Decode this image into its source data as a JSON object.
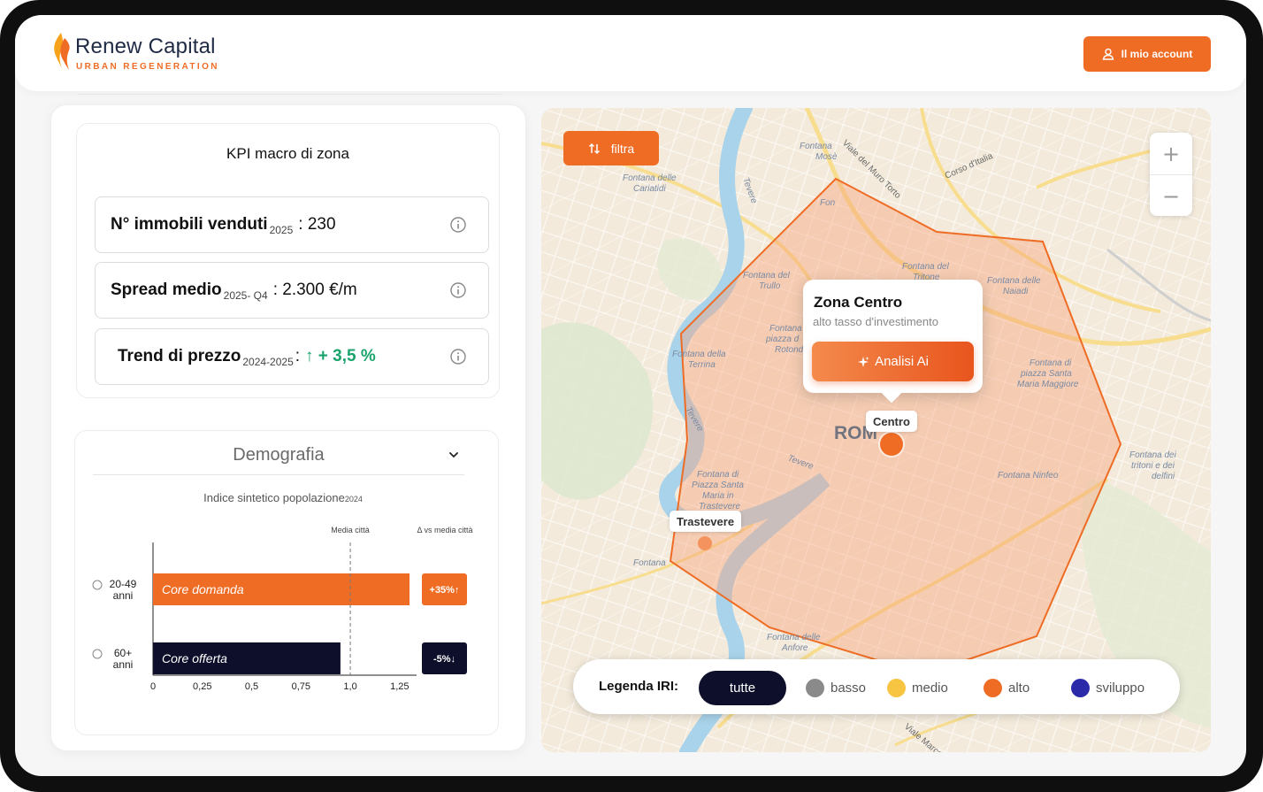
{
  "brand": {
    "name": "Renew Capital",
    "tagline": "URBAN REGENERATION",
    "orange": "#ef6c25",
    "navy": "#0d0f2b"
  },
  "header": {
    "account_label": "Il mio account"
  },
  "kpi": {
    "title": "KPI macro di zona",
    "rows": [
      {
        "label": "N° immobili venduti",
        "sub": "2025",
        "value": ": 230"
      },
      {
        "label": "Spread medio",
        "sub": "2025- Q4",
        "value": ":  2.300 €/m"
      },
      {
        "label": "Trend di prezzo",
        "sub": "2024-2025",
        "value": ":",
        "trend": "↑ + 3,5 %",
        "trend_color": "#1aa36b"
      }
    ]
  },
  "demografia": {
    "title": "Demografia",
    "chart_data": {
      "type": "bar",
      "orientation": "horizontal",
      "title": "Indice sintetico popolazione",
      "title_sub": "2024",
      "categories": [
        "20-49 anni",
        "60+ anni"
      ],
      "category_lines": [
        [
          "20-49",
          "anni"
        ],
        [
          "60+",
          "anni"
        ]
      ],
      "values": [
        1.3,
        0.95
      ],
      "bar_labels": [
        "Core domanda",
        "Core offerta"
      ],
      "bar_colors": [
        "#ef6c25",
        "#0d0f2b"
      ],
      "reference_line": {
        "value": 1.0,
        "label": "Media città"
      },
      "delta_header": "Δ vs media città",
      "deltas": [
        "+35%↑",
        "-5%↓"
      ],
      "xticks": [
        "0",
        "0,25",
        "0,5",
        "0,75",
        "1,0",
        "1,25"
      ],
      "xtick_values": [
        0,
        0.25,
        0.5,
        0.75,
        1.0,
        1.25
      ],
      "xlim": [
        0,
        1.3
      ]
    }
  },
  "map": {
    "filter_label": "filtra",
    "zoom_in": "+",
    "zoom_out": "−",
    "popup": {
      "title": "Zona Centro",
      "subtitle": "alto tasso d'investimento",
      "button": "Analisi Ai"
    },
    "markers": [
      {
        "name": "Centro",
        "level": "alto"
      },
      {
        "name": "Trastevere",
        "level": "alto"
      }
    ],
    "city_label": "ROMA",
    "place_labels": [
      "Fontana delle Cariatidi",
      "Fontana Mosè",
      "Viale del Muro Torto",
      "Corso d'Italia",
      "Fontana del Trullo",
      "Fontana del Tritone",
      "Fontana delle Naiadi",
      "Fontana della Terrina",
      "Fontana di piazza Santa Maria Maggiore",
      "Fontana Ninfeo",
      "Fontana dei tritoni e dei delfini",
      "Fontana di Piazza Santa Maria in Trastevere",
      "Fontana delle Anfore",
      "Tevere",
      "Viale Marco Polo"
    ],
    "legend": {
      "label": "Legenda IRI:",
      "all": "tutte",
      "items": [
        {
          "label": "basso",
          "color": "#8a8a8a"
        },
        {
          "label": "medio",
          "color": "#f7c542"
        },
        {
          "label": "alto",
          "color": "#ef6c25"
        },
        {
          "label": "sviluppo",
          "color": "#2b2aa8"
        }
      ]
    }
  }
}
